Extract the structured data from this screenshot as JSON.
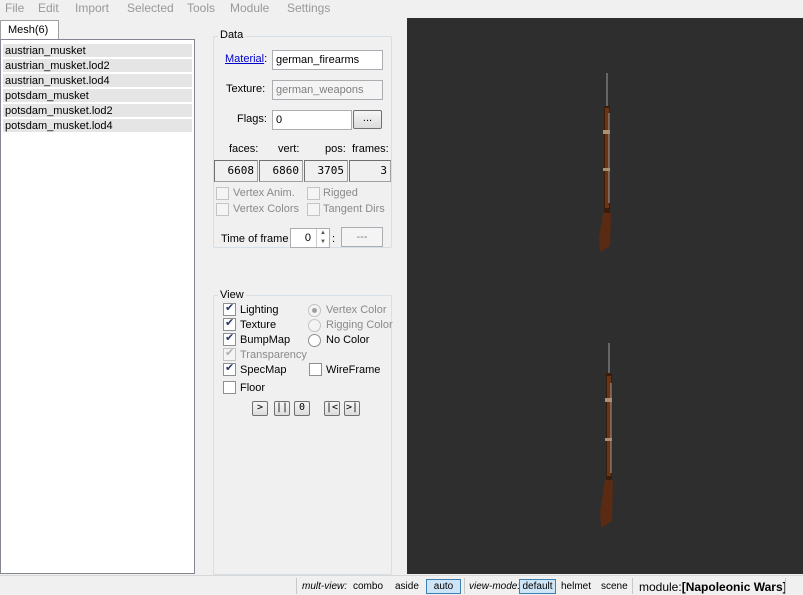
{
  "menu": [
    "File",
    "Edit",
    "Import",
    "Selected",
    "Tools",
    "Module",
    "Settings"
  ],
  "mesh_tab": "Mesh(6)",
  "meshes": [
    "austrian_musket",
    "austrian_musket.lod2",
    "austrian_musket.lod4",
    "potsdam_musket",
    "potsdam_musket.lod2",
    "potsdam_musket.lod4"
  ],
  "data": {
    "title": "Data",
    "material_label": "Material",
    "material_colon": ":",
    "material_value": "german_firearms",
    "texture_label": "Texture:",
    "texture_value": "german_weapons",
    "flags_label": "Flags:",
    "flags_value": "0",
    "flags_btn": "...",
    "faces_label": "faces:",
    "vert_label": "vert:",
    "pos_label": "pos:",
    "frames_label": "frames:",
    "faces": "6608",
    "vert": "6860",
    "pos": "3705",
    "frames": "3",
    "vertex_anim": "Vertex Anim.",
    "rigged": "Rigged",
    "vertex_colors": "Vertex Colors",
    "tangent_dirs": "Tangent Dirs",
    "time_of_frame": "Time of frame",
    "time_value": "0",
    "colon": ":",
    "frame_field": "---"
  },
  "view": {
    "title": "View",
    "lighting": "Lighting",
    "texture": "Texture",
    "bumpmap": "BumpMap",
    "transparency": "Transparency",
    "specmap": "SpecMap",
    "floor": "Floor",
    "vertex_color": "Vertex Color",
    "rigging_color": "Rigging Color",
    "no_color": "No Color",
    "wireframe": "WireFrame",
    "play": ">",
    "pause": "||",
    "stop": "0",
    "prev": "|<",
    "next": ">|"
  },
  "status": {
    "multiview": "mult-view:",
    "combo": "combo",
    "aside": "aside",
    "auto": "auto",
    "viewmode": "view-mode:",
    "default": "default",
    "helmet": "helmet",
    "scene": "scene",
    "module_label": "module:",
    "module_open": "[",
    "module_name": "Napoleonic Wars",
    "module_close": "]"
  },
  "colors": {
    "viewport_bg": "#2e2e2e",
    "wood": "#5a2a12",
    "metal": "#9aa0a4"
  }
}
